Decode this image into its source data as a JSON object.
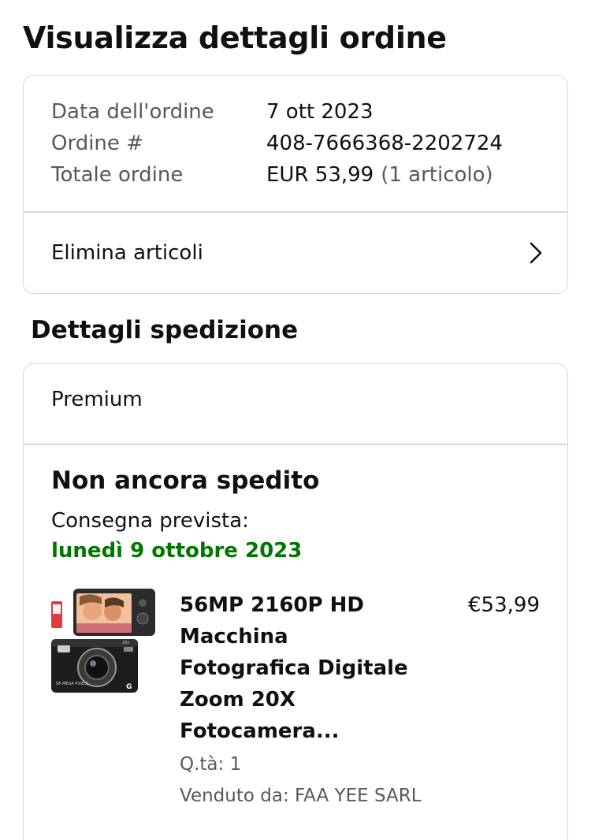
{
  "header": {
    "title": "Visualizza dettagli ordine"
  },
  "summary": {
    "rows": [
      {
        "label": "Data dell'ordine",
        "value": "7 ott 2023"
      },
      {
        "label": "Ordine #",
        "value": "408-7666368-2202724"
      },
      {
        "label": "Totale ordine",
        "value": "EUR 53,99",
        "extra": "(1 articolo)"
      }
    ],
    "remove_items": "Elimina articoli"
  },
  "shipping": {
    "section_title": "Dettagli spedizione",
    "service": "Premium",
    "status": "Non ancora spedito",
    "delivery_label": "Consegna prevista:",
    "delivery_date": "lunedì 9 ottobre 2023",
    "delivery_color": "#007600",
    "item": {
      "title": "56MP 2160P HD Macchina Fotografica Digitale Zoom 20X Fotocamera...",
      "price": "€53,99",
      "quantity": "Q.tà: 1",
      "seller": "Venduto da: FAA YEE SARL",
      "image_icon": "digital-camera-product-image"
    }
  }
}
